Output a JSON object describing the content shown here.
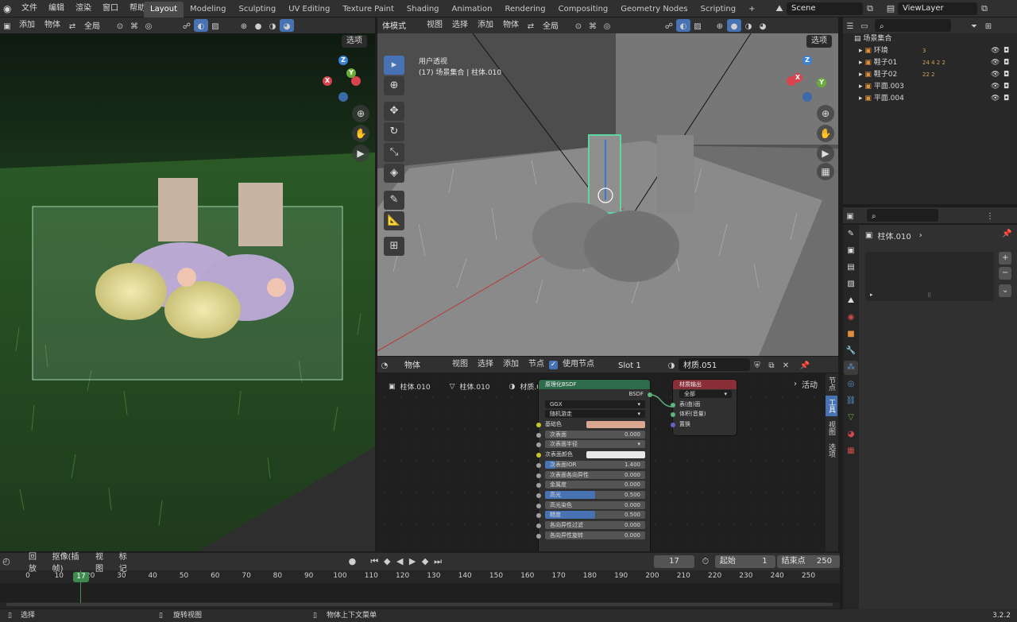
{
  "topbar": {
    "menus": [
      "文件",
      "编辑",
      "渲染",
      "窗口",
      "帮助"
    ],
    "workspaces": [
      "Layout",
      "Modeling",
      "Sculpting",
      "UV Editing",
      "Texture Paint",
      "Shading",
      "Animation",
      "Rendering",
      "Compositing",
      "Geometry Nodes",
      "Scripting"
    ],
    "active_workspace": "Layout",
    "add_tab": "+",
    "scene": "Scene",
    "viewlayer": "ViewLayer"
  },
  "left_view": {
    "menus": [
      "添加",
      "物体"
    ],
    "transform": "全局",
    "options": "选项"
  },
  "right_view": {
    "mode": "体模式",
    "menus": [
      "视图",
      "选择",
      "添加",
      "物体"
    ],
    "transform": "全局",
    "options": "选项",
    "overlay_title": "用户透视",
    "overlay_sub": "(17) 场景集合 | 柱体.010"
  },
  "node_editor": {
    "type": "物体",
    "menus": [
      "视图",
      "选择",
      "添加",
      "节点"
    ],
    "use_nodes": "使用节点",
    "slot": "Slot 1",
    "material": "材质.051",
    "breadcrumb": [
      "柱体.010",
      "柱体.010",
      "材质.051"
    ],
    "active_label": "活动",
    "bsdf": {
      "title": "原理化BSDF",
      "output": "BSDF",
      "distribution": "GGX",
      "subsurface_method": "随机游走",
      "rows": [
        {
          "label": "基础色",
          "kind": "color",
          "color": "#d9a68f"
        },
        {
          "label": "次表面",
          "kind": "value",
          "value": "0.000",
          "fill": 0
        },
        {
          "label": "次表面半径",
          "kind": "dropdown"
        },
        {
          "label": "次表面颜色",
          "kind": "color",
          "color": "#e8e8e8"
        },
        {
          "label": "次表面IOR",
          "kind": "value",
          "value": "1.400",
          "fill": 0.1
        },
        {
          "label": "次表面各向异性",
          "kind": "value",
          "value": "0.000",
          "fill": 0
        },
        {
          "label": "金属度",
          "kind": "value",
          "value": "0.000",
          "fill": 0
        },
        {
          "label": "高光",
          "kind": "value",
          "value": "0.500",
          "fill": 0.5
        },
        {
          "label": "高光染色",
          "kind": "value",
          "value": "0.000",
          "fill": 0
        },
        {
          "label": "糙度",
          "kind": "value",
          "value": "0.500",
          "fill": 0.5
        },
        {
          "label": "各向异性过滤",
          "kind": "value",
          "value": "0.000",
          "fill": 0
        },
        {
          "label": "各向异性旋转",
          "kind": "value",
          "value": "0.000",
          "fill": 0
        }
      ]
    },
    "output": {
      "title": "材质输出",
      "target": "全部",
      "inputs": [
        "表(曲)面",
        "体积(音量)",
        "置换"
      ]
    },
    "side_tabs": [
      "节点",
      "工具",
      "视图",
      "选项"
    ]
  },
  "outliner": {
    "root": "场景集合",
    "items": [
      {
        "name": "环境",
        "badges": "3"
      },
      {
        "name": "鞋子01",
        "badges": "24  4  2  2"
      },
      {
        "name": "鞋子02",
        "badges": "22  2"
      },
      {
        "name": "平面.003",
        "badges": ""
      },
      {
        "name": "平面.004",
        "badges": ""
      }
    ]
  },
  "properties": {
    "object": "柱体.010",
    "tabs": [
      "tool-icon",
      "render-icon",
      "output-icon",
      "view-layer-icon",
      "scene-icon",
      "world-icon",
      "object-icon",
      "modifier-icon",
      "particles-icon",
      "physics-icon",
      "constraints-icon",
      "data-icon",
      "material-icon",
      "texture-icon"
    ]
  },
  "timeline": {
    "menus": [
      "回放",
      "抠像(插帧)",
      "视图",
      "标记"
    ],
    "current_frame": "17",
    "start_label": "起始",
    "start": "1",
    "end_label": "结束点",
    "end": "250",
    "ticks": [
      "0",
      "10",
      "20",
      "30",
      "40",
      "50",
      "60",
      "70",
      "80",
      "90",
      "100",
      "110",
      "120",
      "130",
      "140",
      "150",
      "160",
      "170",
      "180",
      "190",
      "200",
      "210",
      "220",
      "230",
      "240",
      "250"
    ]
  },
  "statusbar": {
    "left": "选择",
    "mid": "旋转视图",
    "right": "物体上下文菜单",
    "version": "3.2.2"
  }
}
